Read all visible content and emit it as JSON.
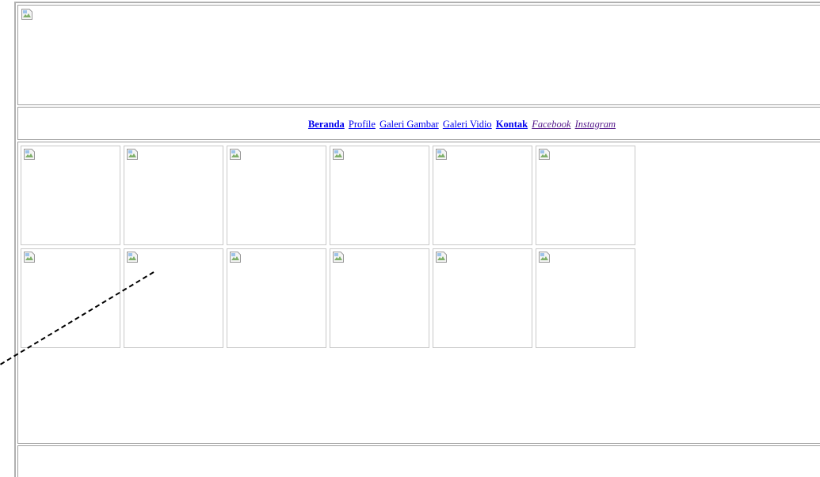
{
  "nav": {
    "links": [
      {
        "label": "Beranda",
        "bold": true,
        "visited": false
      },
      {
        "label": "Profile",
        "bold": false,
        "visited": false
      },
      {
        "label": "Galeri Gambar",
        "bold": false,
        "visited": false
      },
      {
        "label": "Galeri Vidio",
        "bold": false,
        "visited": false
      },
      {
        "label": "Kontak",
        "bold": true,
        "visited": false
      },
      {
        "label": "Facebook",
        "bold": false,
        "visited": true
      },
      {
        "label": "Instagram",
        "bold": false,
        "visited": true
      }
    ]
  },
  "gallery": {
    "rows": 2,
    "columns": 6,
    "icon": "broken-image-icon"
  },
  "colors": {
    "link": "#0000ee",
    "visited_link": "#551a8b",
    "border": "#a0a0a0",
    "thumb_border": "#c8c8c8"
  }
}
